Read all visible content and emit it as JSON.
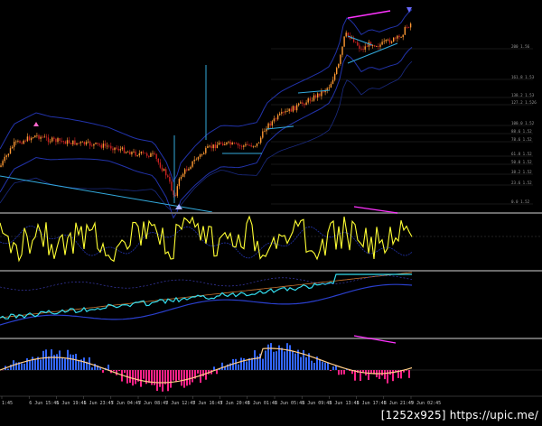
{
  "time_axis": {
    "labels": [
      "1:45",
      "6 Jun 15:45",
      "6 Jun 19:45",
      "6 Jun 23:45",
      "7 Jun 04:45",
      "7 Jun 08:45",
      "7 Jun 12:45",
      "7 Jun 16:45",
      "7 Jun 20:45",
      "8 Jun 01:45",
      "8 Jun 05:45",
      "8 Jun 09:45",
      "8 Jun 13:45",
      "8 Jun 17:45",
      "8 Jun 21:45",
      "9 Jun 02:45"
    ]
  },
  "fib_levels": [
    "200 1.56",
    "161.8 1.53",
    "138.2 1.53",
    "127.2 1.526",
    "100.0 1.52",
    "88.6 1.52",
    "78.6 1.52",
    "61.8 1.52",
    "50.0 1.52",
    "38.2 1.52",
    "23.6 1.52",
    "0.0 1.52"
  ],
  "watermark": "[1252x925] https://upic.me/",
  "colors": {
    "background": "#000000",
    "candle_up": "#ff9933",
    "candle_down": "#cc2222",
    "trendline": "#33aadd",
    "oscillator": "#ffff33",
    "divergence": "#ff33ff",
    "band": "#2233aa",
    "histogram_pos": "#3366ff",
    "histogram_neg": "#ff2288"
  },
  "icons": [
    "down-arrow-marker-icon",
    "up-arrow-marker-icon"
  ]
}
